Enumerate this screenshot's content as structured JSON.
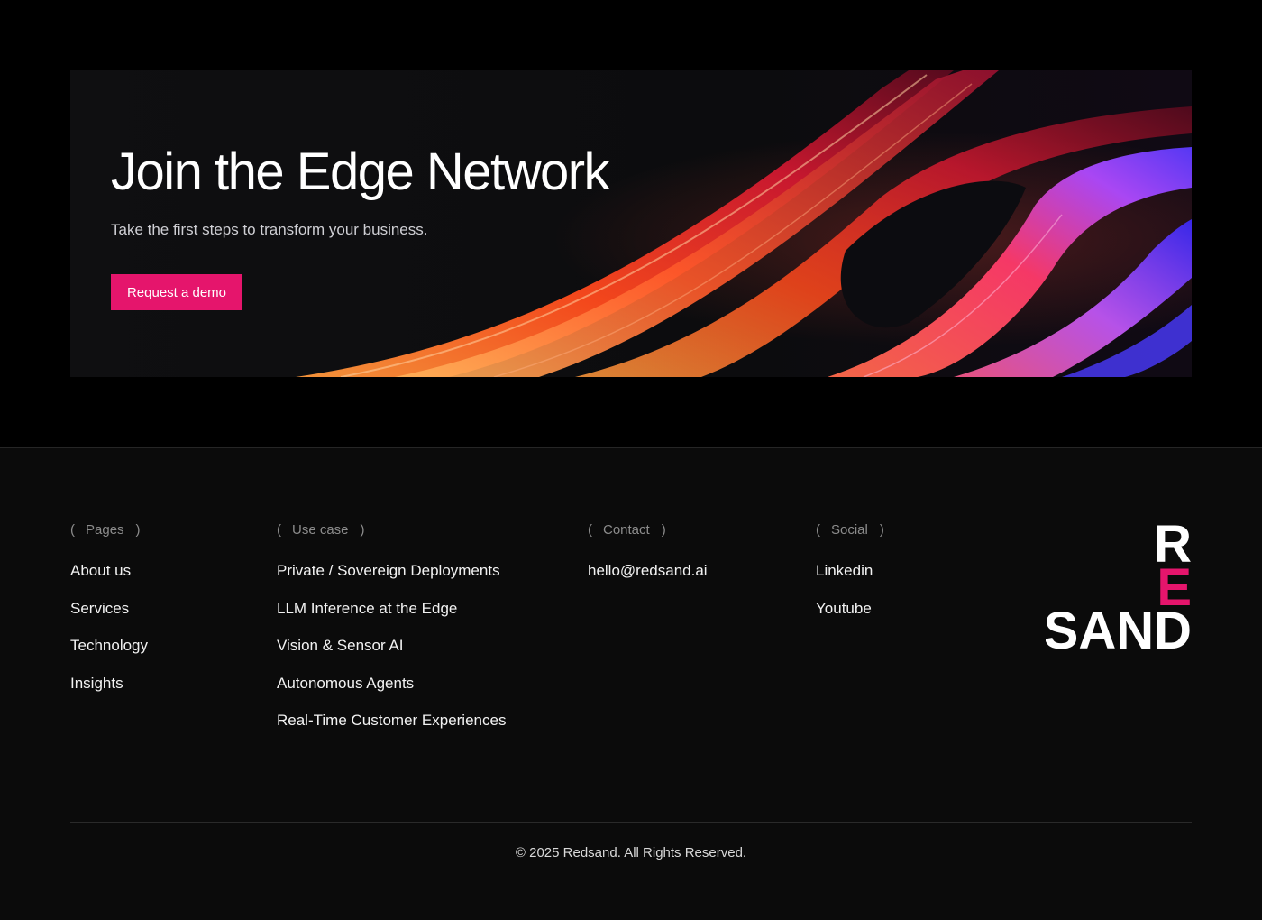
{
  "banner": {
    "title": "Join the Edge Network",
    "subtitle": "Take the first steps to transform your business.",
    "cta_label": "Request a demo"
  },
  "footer": {
    "columns": [
      {
        "heading": "Pages",
        "items": [
          "About us",
          "Services",
          "Technology",
          "Insights"
        ]
      },
      {
        "heading": "Use case",
        "items": [
          "Private / Sovereign Deployments",
          "LLM Inference at the Edge",
          "Vision & Sensor AI",
          "Autonomous Agents",
          "Real-Time Customer Experiences"
        ]
      },
      {
        "heading": "Contact",
        "items": [
          "hello@redsand.ai"
        ]
      },
      {
        "heading": "Social",
        "items": [
          "Linkedin",
          "Youtube"
        ]
      }
    ],
    "logo": {
      "letters_top": "R",
      "letters_mid": "E",
      "letters_bottom": "SAND"
    },
    "copyright": "© 2025 Redsand. All Rights Reserved."
  },
  "colors": {
    "accent": "#e5156c",
    "background": "#000000",
    "footer_bg": "#0b0b0b"
  }
}
